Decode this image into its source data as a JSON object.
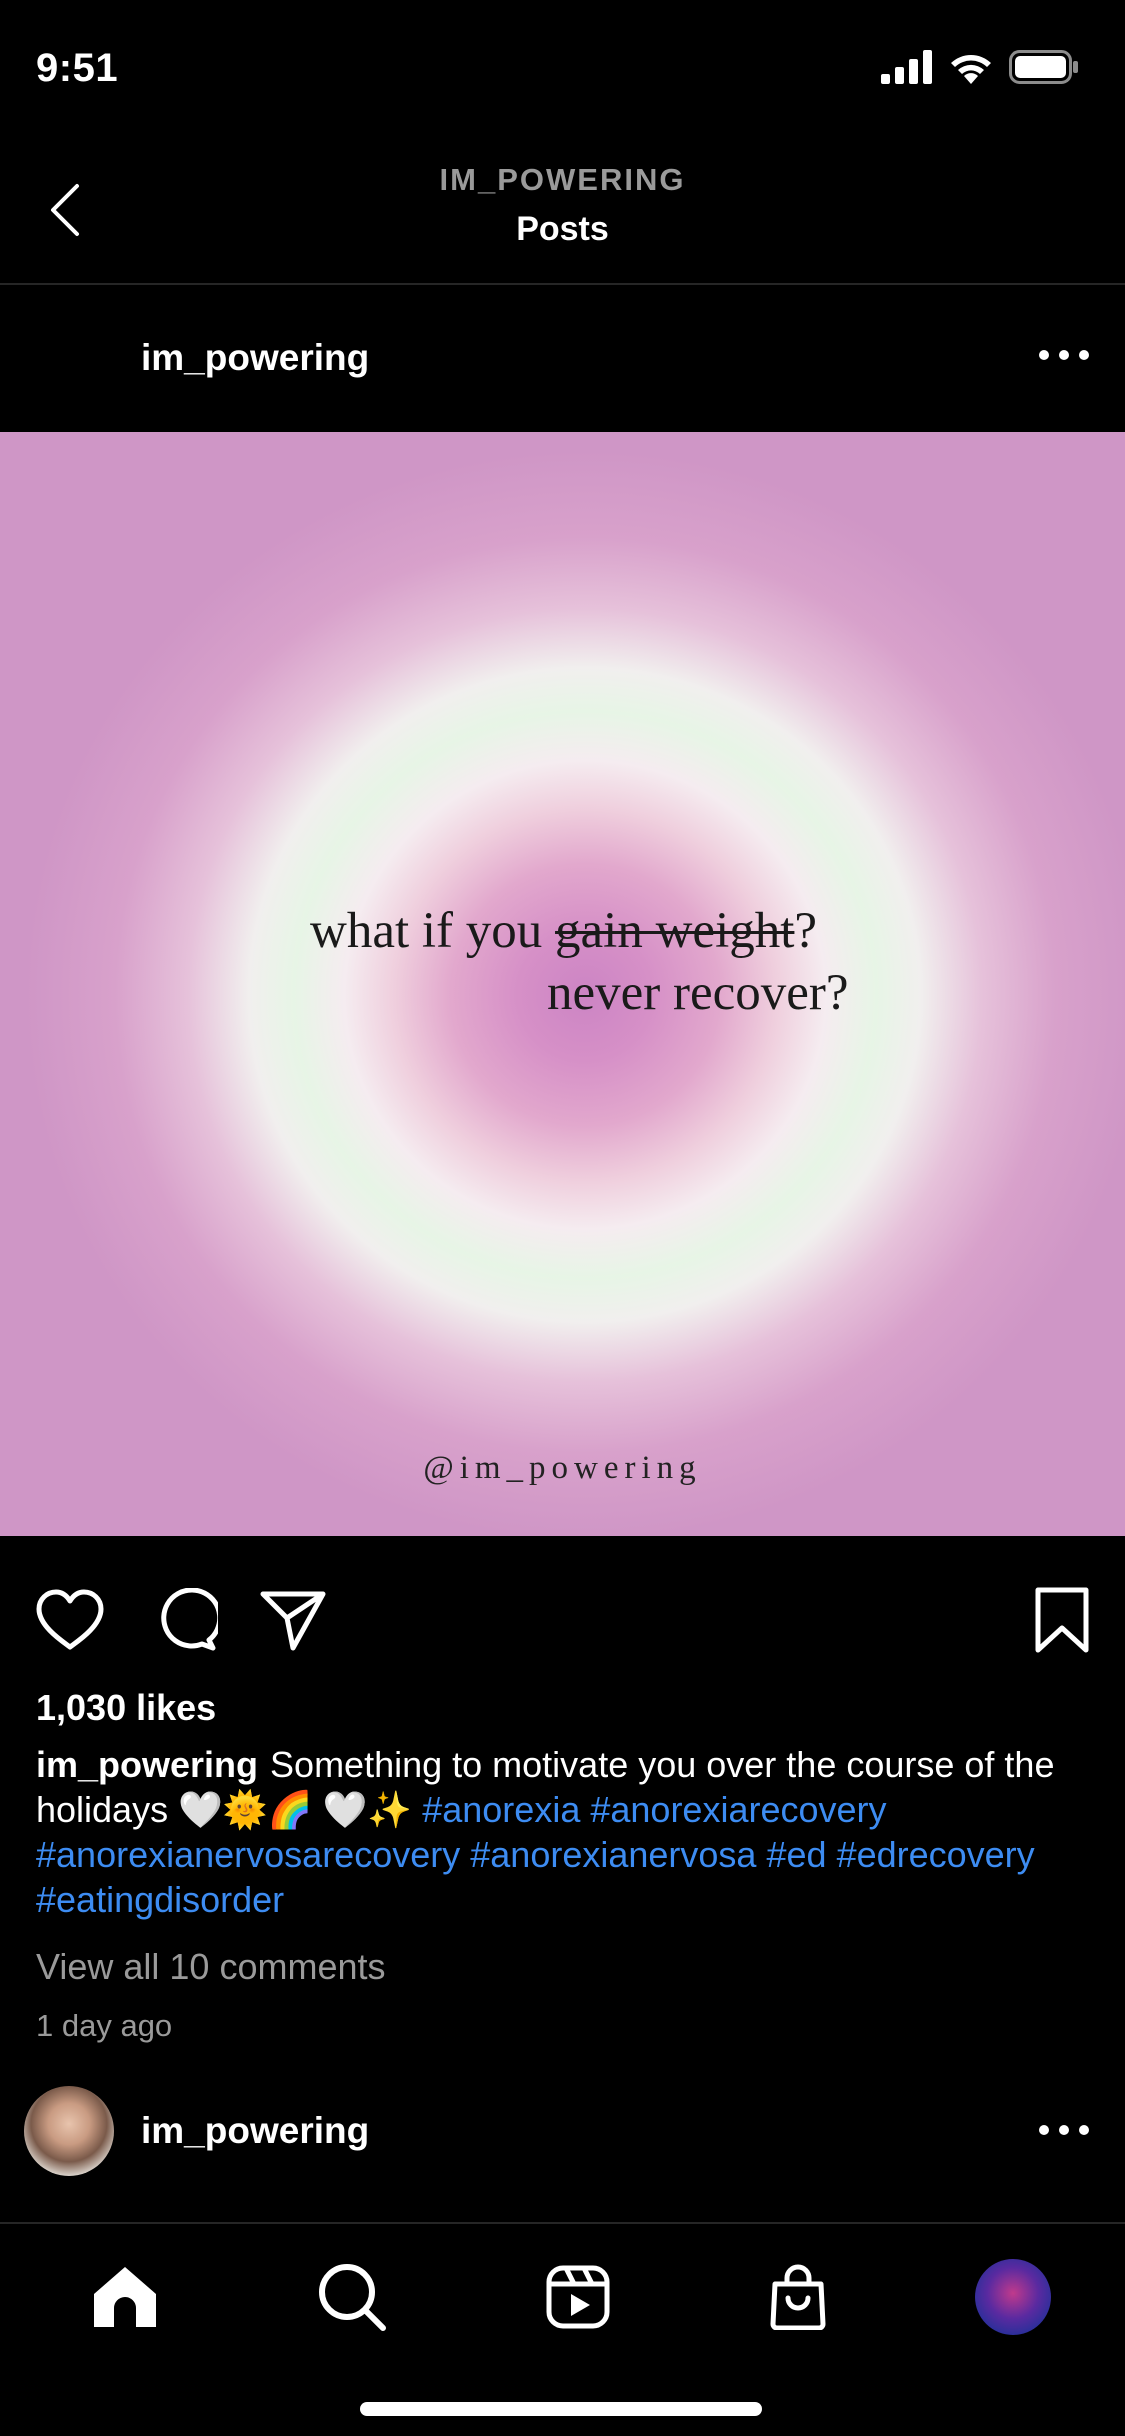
{
  "status_bar": {
    "time": "9:51"
  },
  "header": {
    "subtitle": "IM_POWERING",
    "title": "Posts"
  },
  "post": {
    "username": "im_powering",
    "image": {
      "line1_prefix": "what if you ",
      "line1_strike": "gain weight",
      "line1_suffix": "?",
      "line2": "never recover?",
      "watermark": "@im_powering"
    },
    "likes": "1,030 likes",
    "caption": {
      "username": "im_powering",
      "text": "Something to motivate you over the course of the holidays 🤍🌞🌈 🤍✨ ",
      "hashtags": [
        "#anorexia",
        "#anorexiarecovery",
        "#anorexianervosarecovery",
        "#anorexianervosa",
        "#ed",
        "#edrecovery",
        "#eatingdisorder"
      ]
    },
    "view_comments": "View all 10 comments",
    "timestamp": "1 day ago"
  },
  "next_post": {
    "username": "im_powering"
  },
  "colors": {
    "background": "#000000",
    "hashtag": "#3d8cf2",
    "muted": "#9a9a9a"
  },
  "icons": {
    "status": [
      "signal-icon",
      "wifi-icon",
      "battery-icon"
    ],
    "actions": [
      "heart-icon",
      "comment-icon",
      "share-icon",
      "bookmark-icon"
    ],
    "tabs": [
      "home-icon",
      "search-icon",
      "reels-icon",
      "shop-icon",
      "profile-avatar"
    ]
  }
}
